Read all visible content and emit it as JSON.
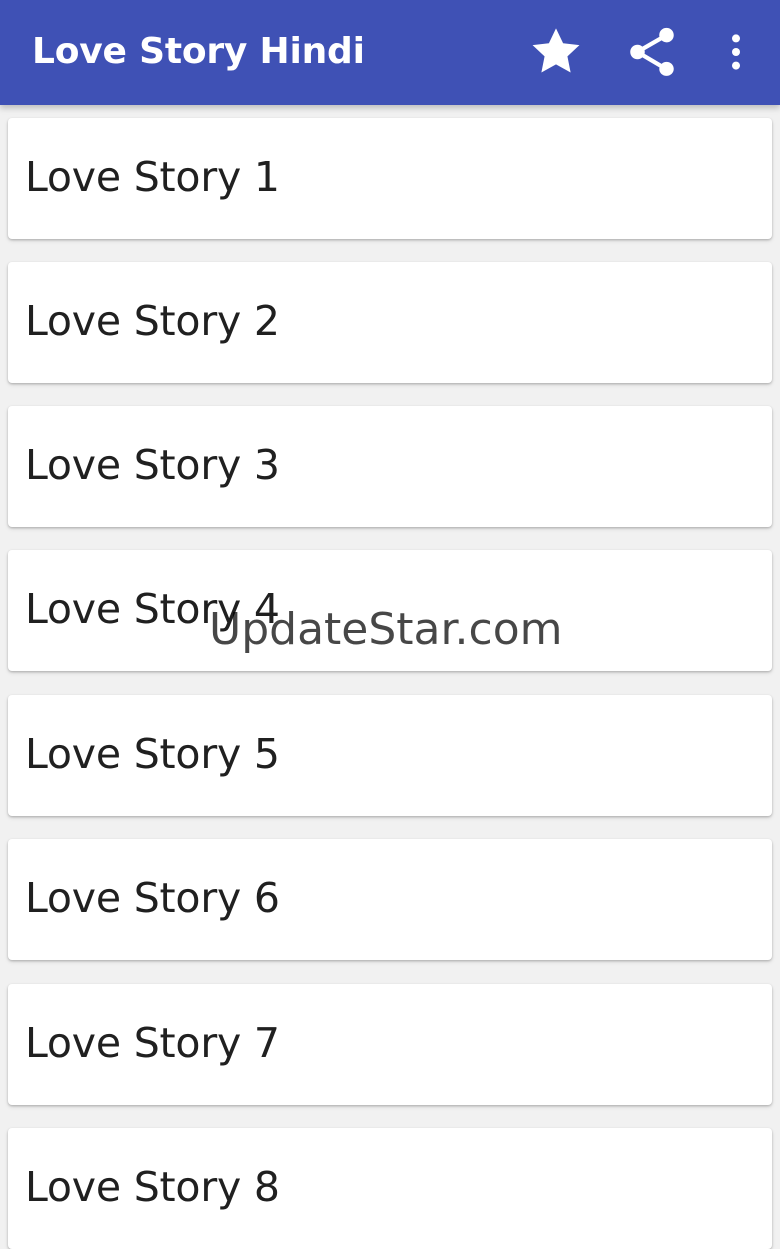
{
  "app_bar": {
    "title": "Love Story Hindi",
    "background_color": "#3f51b5",
    "actions": [
      {
        "icon": "star-icon"
      },
      {
        "icon": "share-icon"
      },
      {
        "icon": "more-vert-icon"
      }
    ]
  },
  "stories": [
    {
      "label": "Love Story 1"
    },
    {
      "label": "Love Story 2"
    },
    {
      "label": "Love Story 3"
    },
    {
      "label": "Love Story 4"
    },
    {
      "label": "Love Story 5"
    },
    {
      "label": "Love Story 6"
    },
    {
      "label": "Love Story 7"
    },
    {
      "label": "Love Story 8"
    }
  ],
  "watermark": {
    "text": "UpdateStar.com"
  }
}
